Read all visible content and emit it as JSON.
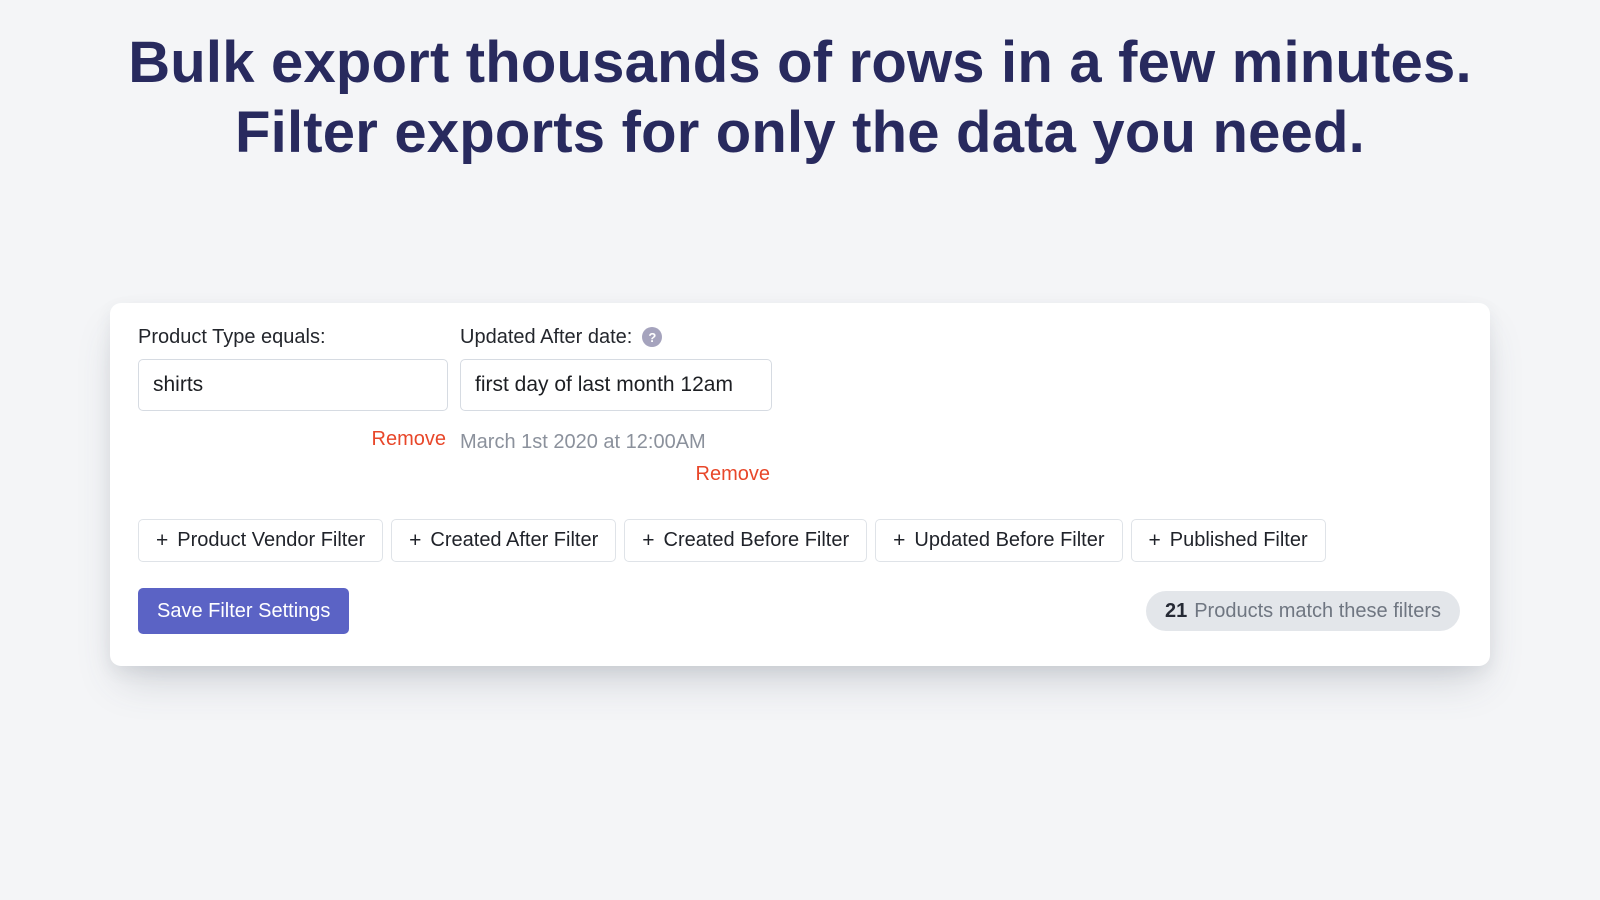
{
  "hero": {
    "line1": "Bulk export thousands of rows in a few minutes.",
    "line2": "Filter exports for only the data you need."
  },
  "colors": {
    "page_background": "#f4f5f7",
    "heading": "#282a5e",
    "card_background": "#ffffff",
    "primary_button": "#5b63c5",
    "remove_link": "#e8472a",
    "badge_background": "#e3e6ea",
    "help_icon": "#a5a3bd",
    "input_border": "#d6dbe2"
  },
  "card": {
    "active_filters": [
      {
        "label": "Product Type equals:",
        "value": "shirts",
        "placeholder": "",
        "has_help_icon": false,
        "help_icon_name": "",
        "resolved_text": "",
        "remove_label": "Remove"
      },
      {
        "label": "Updated After date:",
        "value": "first day of last month 12am",
        "placeholder": "",
        "has_help_icon": true,
        "help_icon_name": "help-circle-icon",
        "help_icon_glyph": "?",
        "resolved_text": "March 1st 2020 at 12:00AM",
        "remove_label": "Remove"
      }
    ],
    "add_filter_buttons": [
      {
        "plus": "+",
        "label": "Product Vendor Filter"
      },
      {
        "plus": "+",
        "label": "Created After Filter"
      },
      {
        "plus": "+",
        "label": "Created Before Filter"
      },
      {
        "plus": "+",
        "label": "Updated Before Filter"
      },
      {
        "plus": "+",
        "label": "Published Filter"
      }
    ],
    "footer": {
      "save_label": "Save Filter Settings",
      "match_count": "21",
      "match_text": "Products match these filters"
    }
  }
}
